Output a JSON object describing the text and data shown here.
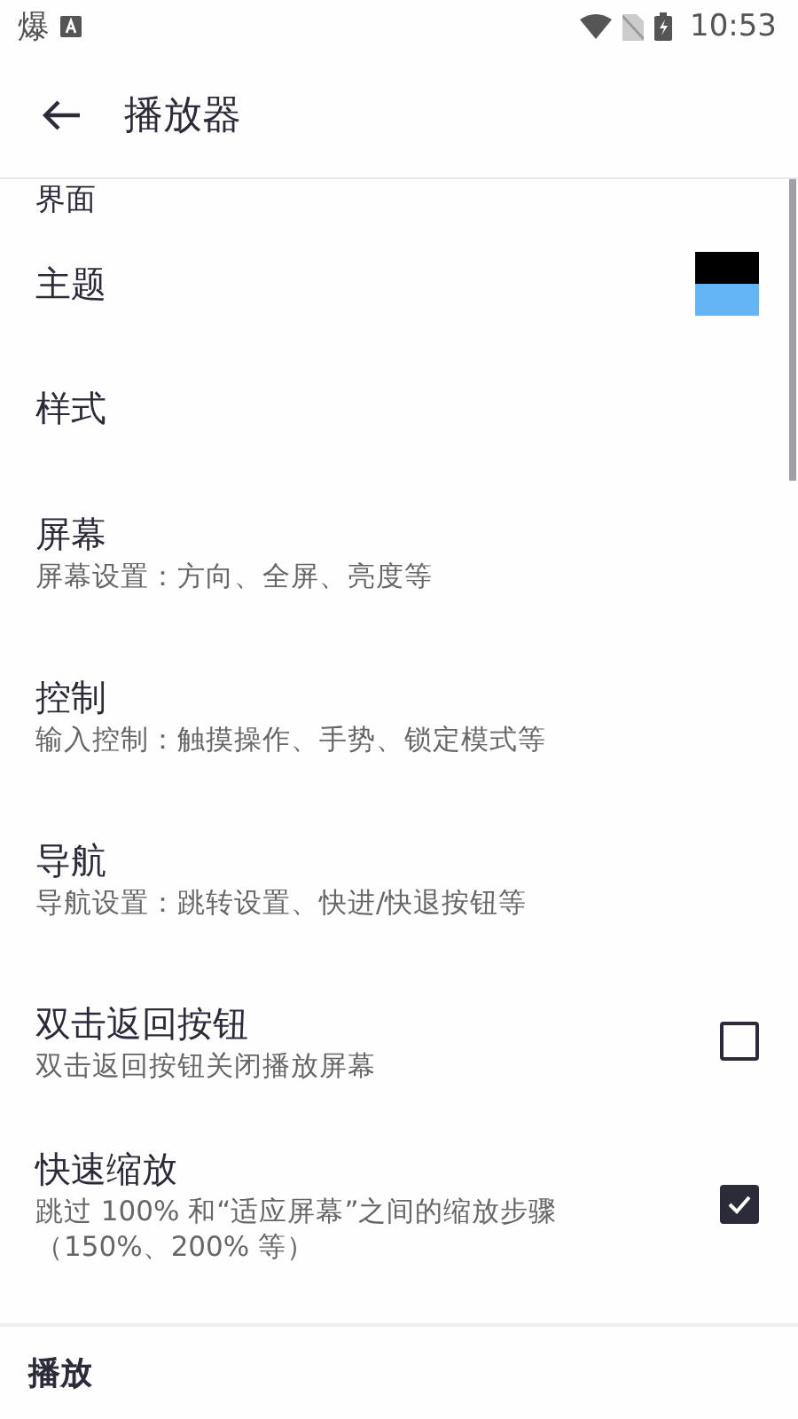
{
  "status_bar": {
    "notification": "爆",
    "time": "10:53"
  },
  "app_bar": {
    "title": "播放器"
  },
  "section": {
    "title": "界面"
  },
  "items": [
    {
      "kind": "swatch",
      "title": "主题",
      "swatch": [
        {
          "color": "#000000"
        },
        {
          "color": "#64b5f6"
        }
      ]
    },
    {
      "kind": "plain",
      "title": "样式"
    },
    {
      "kind": "plain",
      "title": "屏幕",
      "summary": "屏幕设置：方向、全屏、亮度等"
    },
    {
      "kind": "plain",
      "title": "控制",
      "summary": "输入控制：触摸操作、手势、锁定模式等"
    },
    {
      "kind": "plain",
      "title": "导航",
      "summary": "导航设置：跳转设置、快进/快退按钮等"
    },
    {
      "kind": "checkbox",
      "title": "双击返回按钮",
      "summary": "双击返回按钮关闭播放屏幕",
      "checked": false
    },
    {
      "kind": "checkbox",
      "title": "快速缩放",
      "summary": "跳过 100% 和“适应屏幕”之间的缩放步骤（150%、200% 等）",
      "checked": true
    }
  ],
  "bottom_bar": {
    "title": "播放"
  }
}
